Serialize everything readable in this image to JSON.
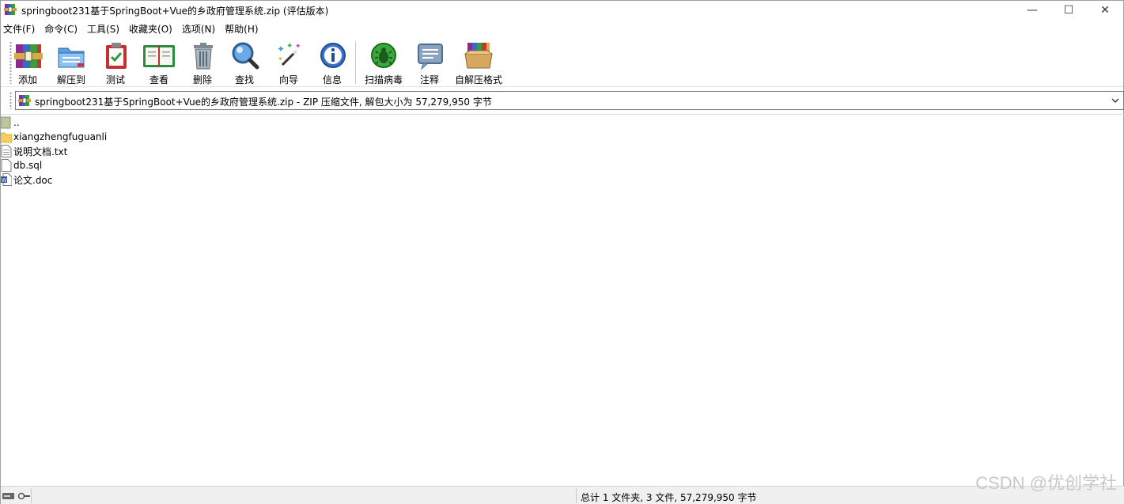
{
  "window": {
    "title": "springboot231基于SpringBoot+Vue的乡政府管理系统.zip (评估版本)",
    "controls": {
      "minimize": "—",
      "maximize": "☐",
      "close": "✕"
    }
  },
  "menu": [
    "文件(F)",
    "命令(C)",
    "工具(S)",
    "收藏夹(O)",
    "选项(N)",
    "帮助(H)"
  ],
  "toolbar": {
    "add": "添加",
    "extract": "解压到",
    "test": "测试",
    "view": "查看",
    "delete": "删除",
    "find": "查找",
    "wizard": "向导",
    "info": "信息",
    "virus_scan": "扫描病毒",
    "comment": "注释",
    "sfx": "自解压格式"
  },
  "address": {
    "path": "springboot231基于SpringBoot+Vue的乡政府管理系统.zip - ZIP 压缩文件, 解包大小为 57,279,950 字节"
  },
  "files": [
    {
      "name": "..",
      "icon": "up-folder-icon"
    },
    {
      "name": "xiangzhengfuguanli",
      "icon": "folder-icon"
    },
    {
      "name": "说明文档.txt",
      "icon": "text-file-icon"
    },
    {
      "name": "db.sql",
      "icon": "file-icon"
    },
    {
      "name": "论文.doc",
      "icon": "word-file-icon"
    }
  ],
  "status": {
    "summary": "总计 1 文件夹, 3 文件, 57,279,950 字节"
  },
  "watermark": "CSDN @优创学社"
}
